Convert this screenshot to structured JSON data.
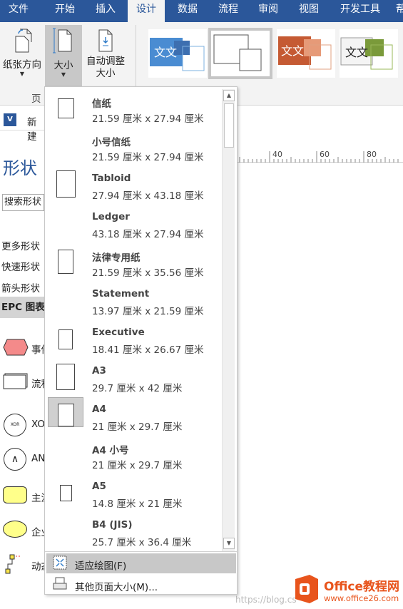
{
  "tabs": [
    "文件",
    "开始",
    "插入",
    "设计",
    "数据",
    "流程",
    "审阅",
    "视图",
    "开发工具",
    "帮"
  ],
  "ribbon": {
    "paper_orientation": "纸张方向",
    "size": "大小",
    "autofit_1": "自动调整",
    "autofit_2": "大小",
    "group_label": "页"
  },
  "theme_text": "文文",
  "doc_bar": {
    "new_label": "新建"
  },
  "shapes_pane": {
    "title": "形状",
    "search_placeholder": "搜索形状",
    "more": "更多形状",
    "quick": "快速形状",
    "arrow": "箭头形状",
    "epc": "EPC 图表",
    "event": "事件",
    "flow": "流程",
    "xor": "XOR",
    "xor_symbol": "XOR",
    "and": "AND",
    "and_symbol": "∧",
    "main": "主流",
    "org": "企业",
    "action": "动态"
  },
  "ruler": [
    "40",
    "60",
    "80"
  ],
  "size_menu": {
    "items": [
      {
        "name": "信纸",
        "size": "21.59 厘米 x 27.94 厘米"
      },
      {
        "name": "小号信纸",
        "size": "21.59 厘米 x 27.94 厘米"
      },
      {
        "name": "Tabloid",
        "size": "27.94 厘米 x 43.18 厘米"
      },
      {
        "name": "Ledger",
        "size": "43.18 厘米 x 27.94 厘米"
      },
      {
        "name": "法律专用纸",
        "size": "21.59 厘米 x 35.56 厘米"
      },
      {
        "name": "Statement",
        "size": "13.97 厘米 x 21.59 厘米"
      },
      {
        "name": "Executive",
        "size": "18.41 厘米 x 26.67 厘米"
      },
      {
        "name": "A3",
        "size": "29.7 厘米 x 42 厘米"
      },
      {
        "name": "A4",
        "size": "21 厘米 x 29.7 厘米"
      },
      {
        "name": "A4 小号",
        "size": "21 厘米 x 29.7 厘米"
      },
      {
        "name": "A5",
        "size": "14.8 厘米 x 21 厘米"
      },
      {
        "name": "B4 (JIS)",
        "size": "25.7 厘米 x 36.4 厘米"
      }
    ],
    "selected": "A4",
    "fit_to_drawing": "适应绘图(F)",
    "more_sizes": "其他页面大小(M)..."
  },
  "watermark": {
    "url": "https://blog.cs",
    "brand": "Office教程网",
    "site": "www.office26.com"
  },
  "colors": {
    "accent": "#2b579a",
    "brand_orange": "#e8541c"
  }
}
